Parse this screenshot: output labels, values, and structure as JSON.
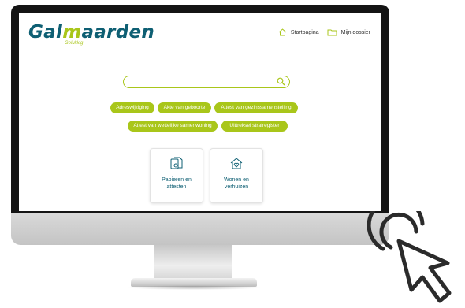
{
  "site": {
    "logo_main_left": "Gal",
    "logo_main_m": "m",
    "logo_main_right": "aarden",
    "logo_sub": "Gelukkig"
  },
  "nav": {
    "home_label": "Startpagina",
    "dossier_label": "Mijn dossier"
  },
  "search": {
    "placeholder": "",
    "value": ""
  },
  "tags": [
    "Adreswijziging",
    "Akte van geboorte",
    "Attest van gezinssamenstelling",
    "Attest van wettelijke samenwoning",
    "Uittreksel strafregister"
  ],
  "cards": [
    {
      "line1": "Papieren en",
      "line2": "attesten",
      "icon": "documents-icon"
    },
    {
      "line1": "Wonen en",
      "line2": "verhuizen",
      "icon": "house-heart-icon"
    }
  ],
  "colors": {
    "brand_green": "#a9c61a",
    "brand_teal": "#0e5f73",
    "bezel": "#141414"
  }
}
